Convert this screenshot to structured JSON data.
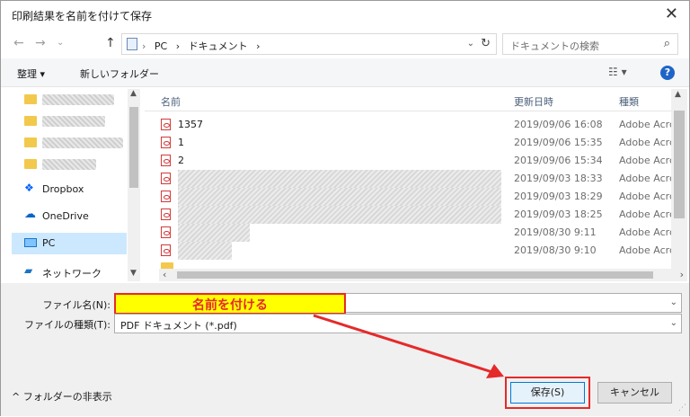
{
  "window": {
    "title": "印刷結果を名前を付けて保存"
  },
  "address": {
    "crumbs": [
      "PC",
      "›",
      "ドキュメント",
      "›"
    ],
    "search_placeholder": "ドキュメントの検索"
  },
  "toolbar": {
    "organize": "整理 ▾",
    "new_folder": "新しいフォルダー"
  },
  "nav": {
    "items": [
      {
        "label": "Dropbox"
      },
      {
        "label": "OneDrive"
      },
      {
        "label": "PC"
      },
      {
        "label": "ネットワーク"
      }
    ]
  },
  "columns": {
    "name": "名前",
    "date": "更新日時",
    "type": "種類"
  },
  "files": [
    {
      "name": "1357",
      "date": "2019/09/06 16:08",
      "type": "Adobe Acrc"
    },
    {
      "name": "1",
      "date": "2019/09/06 15:35",
      "type": "Adobe Acrc"
    },
    {
      "name": "2",
      "date": "2019/09/06 15:34",
      "type": "Adobe Acrc"
    },
    {
      "name": "",
      "date": "2019/09/03 18:33",
      "type": "Adobe Acrc"
    },
    {
      "name": "",
      "date": "2019/09/03 18:29",
      "type": "Adobe Acrc"
    },
    {
      "name": "",
      "date": "2019/09/03 18:25",
      "type": "Adobe Acrc"
    },
    {
      "name": "",
      "date": "2019/08/30 9:11",
      "type": "Adobe Acrc"
    },
    {
      "name": "",
      "date": "2019/08/30 9:10",
      "type": "Adobe Acrc"
    }
  ],
  "form": {
    "filename_label": "ファイル名(N):",
    "filetype_label": "ファイルの種類(T):",
    "filetype_value": "PDF ドキュメント (*.pdf)",
    "annotation": "名前を付ける"
  },
  "footer": {
    "hide_folders": "^ フォルダーの非表示",
    "save": "保存(S)",
    "cancel": "キャンセル"
  },
  "colors": {
    "accent": "#0078d7",
    "annotation_red": "#e52a2a",
    "annotation_yellow": "#ffff00"
  }
}
